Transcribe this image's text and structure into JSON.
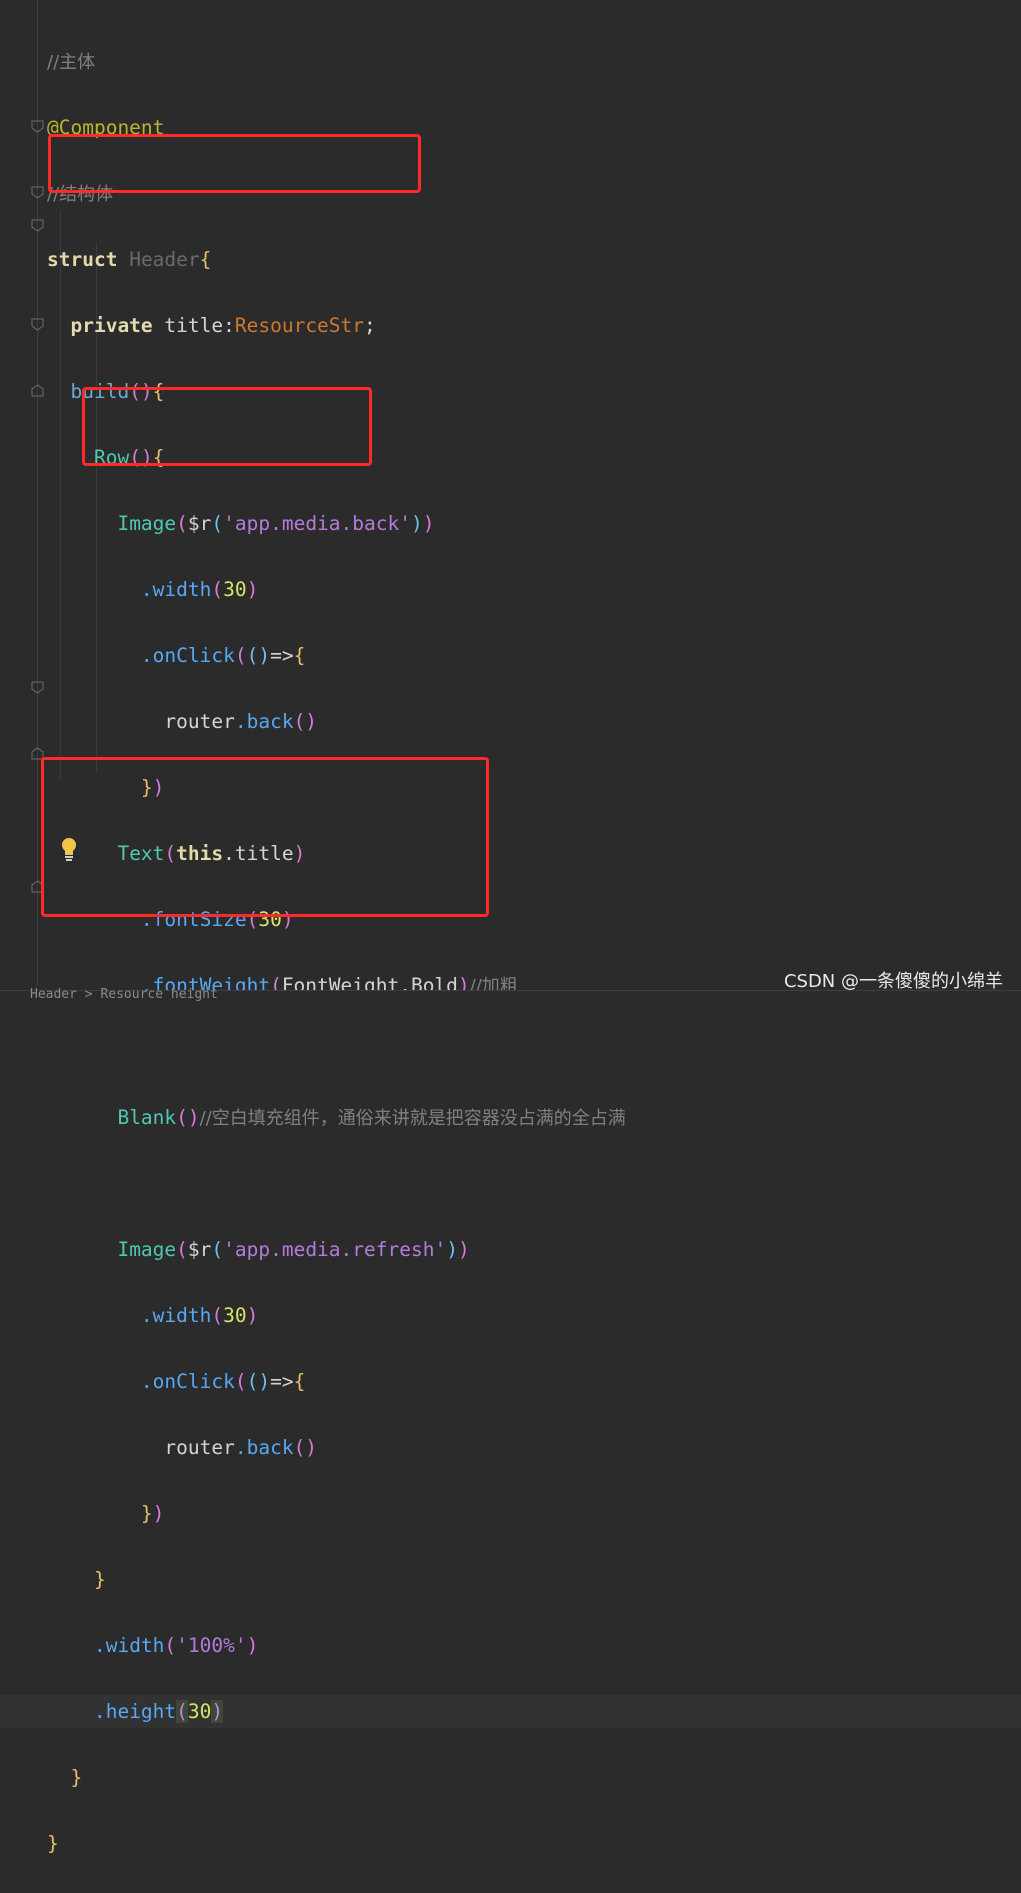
{
  "editor": {
    "comment_main": "//主体",
    "annotation": "@Component",
    "comment_struct": "//结构体",
    "struct_kw": "struct",
    "struct_name": "Header",
    "private_kw": "private",
    "field_name": "title",
    "field_type": "ResourceStr",
    "build": "build",
    "row": "Row",
    "image": "Image",
    "res_fn": "$r",
    "back_res": "'app.media.back'",
    "refresh_res": "'app.media.refresh'",
    "width_method": ".width",
    "width_val": "30",
    "onclick": ".onClick",
    "router": "router",
    "back": ".back",
    "text": "Text",
    "this_kw": "this",
    "title_prop": ".title",
    "font_size": ".fontSize",
    "font_size_val": "30",
    "font_weight": ".fontWeight",
    "font_weight_enum": "FontWeight.Bold",
    "comment_bold": "//加粗",
    "blank": "Blank",
    "comment_blank": "//空白填充组件，通俗来讲就是把容器没占满的全占满",
    "row_width_val": "'100%'",
    "height_method": ".height",
    "height_val": "30"
  },
  "watermark": "CSDN @一条傻傻的小绵羊",
  "bottom_strip_text": "Header > Resource height"
}
